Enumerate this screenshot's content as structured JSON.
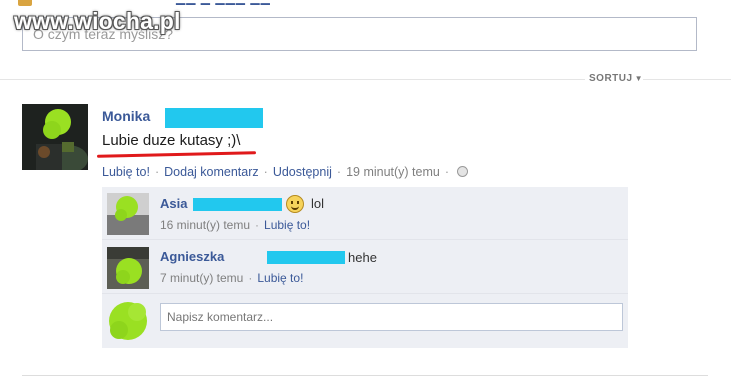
{
  "watermark": "www.wiocha.pl",
  "composer": {
    "placeholder": "O czym teraz myślisz?"
  },
  "sort": {
    "label": "SORTUJ"
  },
  "post": {
    "author": "Monika",
    "text": "Lubie duze kutasy ;)\\",
    "actions": {
      "like": "Lubię to!",
      "comment": "Dodaj komentarz",
      "share": "Udostępnij",
      "time": "19 minut(y) temu"
    }
  },
  "comments": [
    {
      "author": "Asia",
      "text": "lol",
      "time": "16 minut(y) temu",
      "like": "Lubię to!",
      "emoticon": "smiley-icon"
    },
    {
      "author": "Agnieszka",
      "text": "hehe",
      "time": "7 minut(y) temu",
      "like": "Lubię to!"
    }
  ],
  "reply": {
    "placeholder": "Napisz komentarz..."
  },
  "colors": {
    "link": "#3b5998",
    "redaction": "#22c8ee",
    "underline": "#e0191b",
    "scribble": "#9ae022",
    "comment_bg": "#edeff4"
  }
}
